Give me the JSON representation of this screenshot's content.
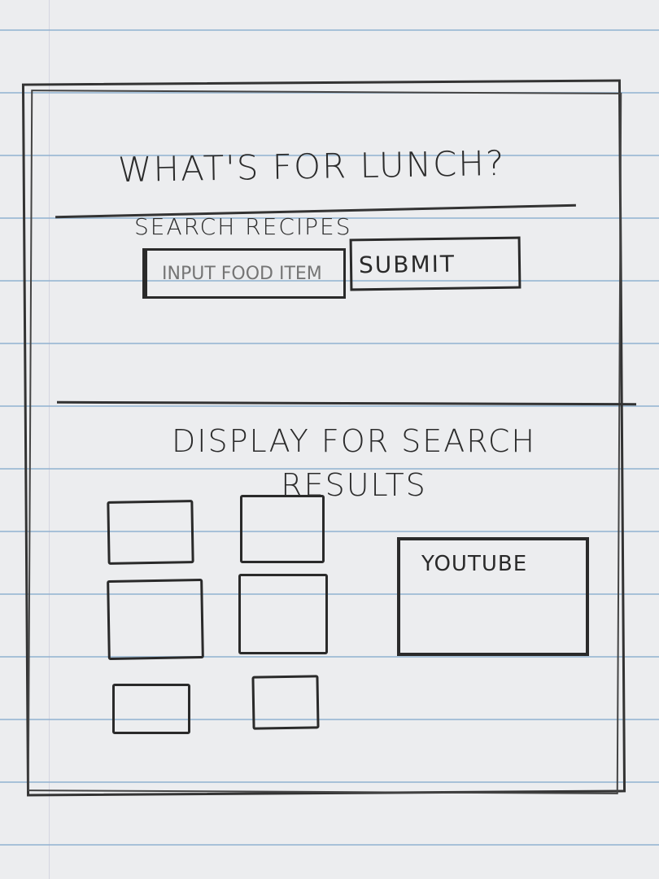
{
  "header": {
    "title": "WHAT'S FOR LUNCH?"
  },
  "search": {
    "label": "SEARCH RECIPES",
    "input_placeholder": "INPUT FOOD ITEM",
    "submit_label": "SUBMIT"
  },
  "results": {
    "title": "DISPLAY FOR SEARCH RESULTS",
    "result_cards": 6,
    "video_label": "YOUTUBE"
  }
}
